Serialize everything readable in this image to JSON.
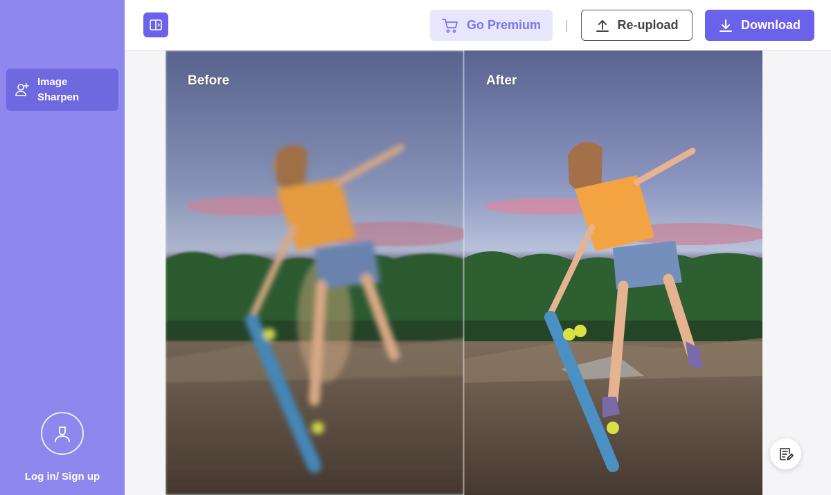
{
  "sidebar": {
    "items": [
      {
        "label": "Image Sharpen",
        "icon": "user-add-icon"
      }
    ],
    "login_label": "Log in/ Sign up",
    "bg_color": "#8d87ee",
    "active_color": "#6f69e0"
  },
  "toolbar": {
    "compare_icon": "split-view-icon",
    "premium_label": "Go Premium",
    "separator": "|",
    "reupload_label": "Re-upload",
    "download_label": "Download",
    "accent_color": "#6a62ea"
  },
  "compare": {
    "before_label": "Before",
    "after_label": "After"
  },
  "feedback_icon": "feedback-edit-icon"
}
